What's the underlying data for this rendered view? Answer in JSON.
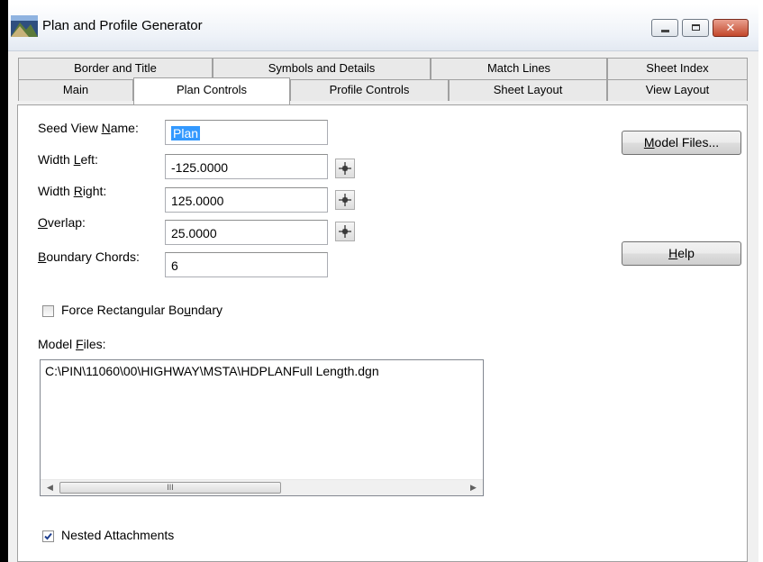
{
  "window": {
    "title": "Plan and Profile Generator",
    "controls": {
      "minimize": "minimize",
      "maximize": "maximize",
      "close": "✕"
    }
  },
  "tabs": {
    "row1": [
      "Border and Title",
      "Symbols and Details",
      "Match Lines",
      "Sheet Index"
    ],
    "row2": [
      "Main",
      "Plan Controls",
      "Profile Controls",
      "Sheet Layout",
      "View Layout"
    ],
    "selected": "Plan Controls"
  },
  "form": {
    "seed_view_name": {
      "label_pre": "Seed View ",
      "label_key": "N",
      "label_post": "ame:",
      "value": "Plan"
    },
    "width_left": {
      "label_pre": "Width ",
      "label_key": "L",
      "label_post": "eft:",
      "value": "-125.0000"
    },
    "width_right": {
      "label_pre": "Width ",
      "label_key": "R",
      "label_post": "ight:",
      "value": "125.0000"
    },
    "overlap": {
      "label_pre": "",
      "label_key": "O",
      "label_post": "verlap:",
      "value": "25.0000"
    },
    "boundary_chords": {
      "label_pre": "",
      "label_key": "B",
      "label_post": "oundary Chords:",
      "value": "6"
    },
    "force_rect": {
      "label_pre": "Force Rectangular Bo",
      "label_key": "u",
      "label_post": "ndary",
      "checked": false
    },
    "model_files": {
      "label_pre": "Model ",
      "label_key": "F",
      "label_post": "iles:",
      "items": [
        "C:\\PIN\\11060\\00\\HIGHWAY\\MSTA\\HDPLANFull Length.dgn"
      ]
    },
    "nested": {
      "label": "Nested Attachments",
      "checked": true
    }
  },
  "buttons": {
    "model_files": {
      "key": "M",
      "rest": "odel Files..."
    },
    "help": {
      "key": "H",
      "rest": "elp"
    }
  },
  "scrollbar": {
    "left_arrow": "◀",
    "right_arrow": "▶",
    "thumb_grip": "III"
  },
  "colors": {
    "selection": "#3399ff",
    "close_button": "#c2472b",
    "panel": "#ffffff",
    "window": "#f0f0f0"
  }
}
